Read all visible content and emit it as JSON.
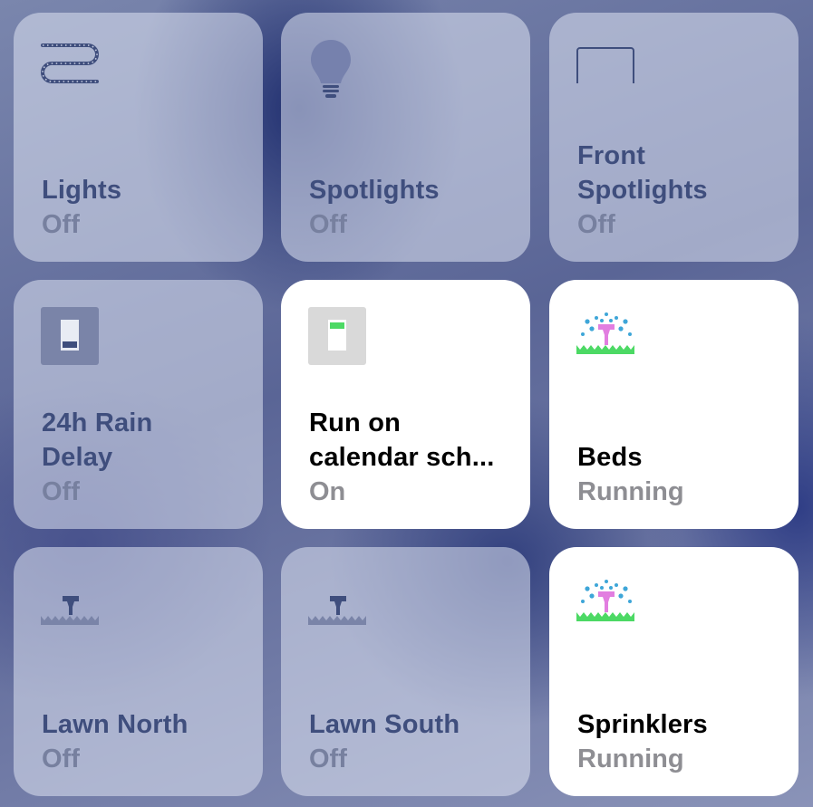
{
  "tiles": [
    {
      "name": "Lights",
      "status": "Off",
      "icon": "light-strip-icon",
      "state": "off"
    },
    {
      "name": "Spotlights",
      "status": "Off",
      "icon": "lightbulb-icon",
      "state": "off"
    },
    {
      "name": "Front\nSpotlights",
      "status": "Off",
      "icon": "rectangle-light-icon",
      "state": "off"
    },
    {
      "name": "24h Rain\nDelay",
      "status": "Off",
      "icon": "switch-off-icon",
      "state": "off"
    },
    {
      "name": "Run on\ncalendar sch...",
      "status": "On",
      "icon": "switch-on-icon",
      "state": "on"
    },
    {
      "name": "Beds",
      "status": "Running",
      "icon": "sprinkler-active-icon",
      "state": "on"
    },
    {
      "name": "Lawn North",
      "status": "Off",
      "icon": "sprinkler-idle-icon",
      "state": "off"
    },
    {
      "name": "Lawn South",
      "status": "Off",
      "icon": "sprinkler-idle-icon",
      "state": "off"
    },
    {
      "name": "Sprinklers",
      "status": "Running",
      "icon": "sprinkler-active-icon",
      "state": "on"
    }
  ],
  "colors": {
    "tile_off_text": "#3f4e7d",
    "tile_off_status": "#77809f",
    "tile_on_text": "#000000",
    "tile_on_status": "#8e8e93",
    "accent_green": "#4cd964",
    "water_blue": "#3ea6d8",
    "sprinkler_pink": "#e27ee0"
  }
}
